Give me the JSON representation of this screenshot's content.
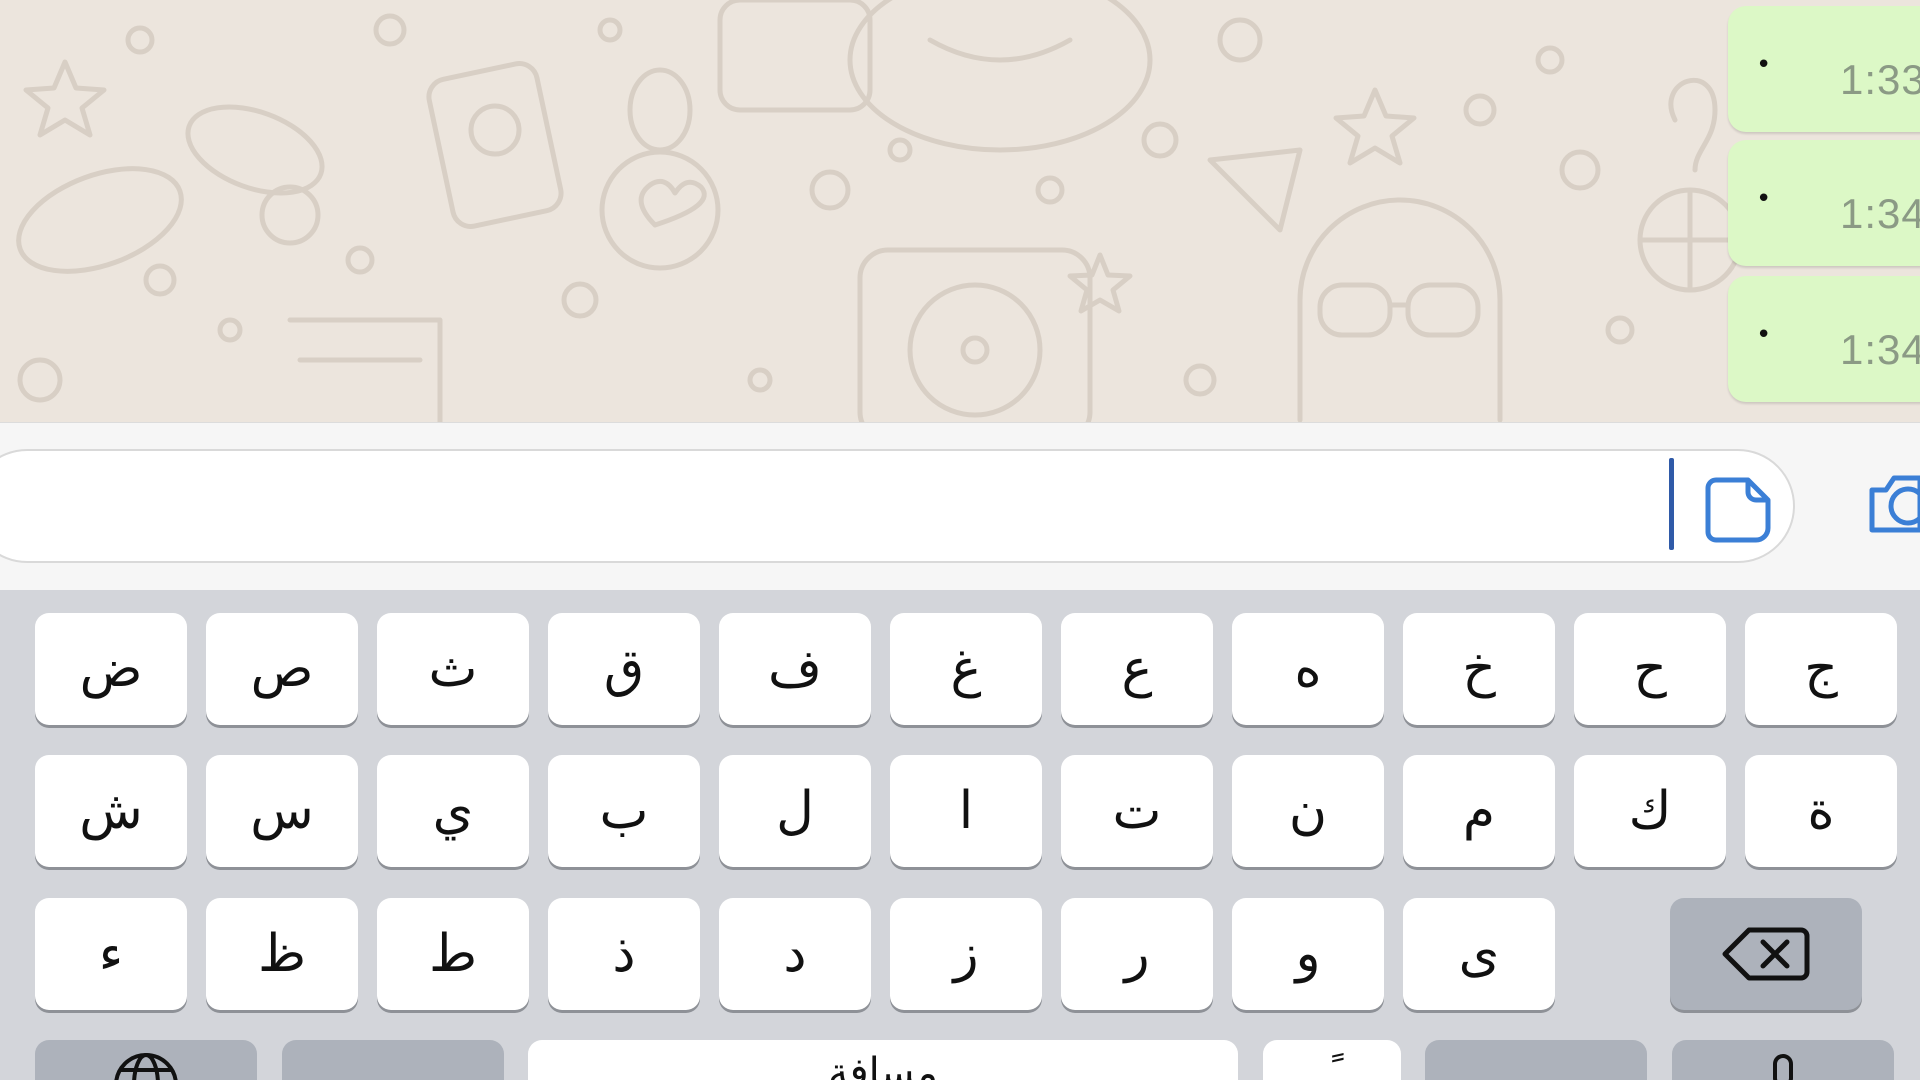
{
  "chat": {
    "messages": [
      {
        "text": "•",
        "time": "1:33"
      },
      {
        "text": "•",
        "time": "1:34"
      },
      {
        "text": "•",
        "time": "1:34"
      }
    ]
  },
  "input": {
    "value": "",
    "sticker_icon": "sticker-icon",
    "camera_icon": "camera-icon"
  },
  "keyboard": {
    "layout": "arabic",
    "row1": [
      "ج",
      "ح",
      "خ",
      "ه",
      "ع",
      "غ",
      "ف",
      "ق",
      "ث",
      "ص",
      "ض"
    ],
    "row2": [
      "ة",
      "ك",
      "م",
      "ن",
      "ت",
      "ا",
      "ل",
      "ب",
      "ي",
      "س",
      "ش"
    ],
    "row3": [
      "ى",
      "و",
      "ر",
      "ز",
      "د",
      "ذ",
      "ط",
      "ظ",
      "ء"
    ],
    "delete_icon": "backspace-icon",
    "bottom_row": {
      "globe_icon": "globe-icon",
      "space_label": "مسافة",
      "punct_label": "ـًـ",
      "mic_icon": "microphone-icon"
    }
  },
  "colors": {
    "chat_background": "#ece5dd",
    "outgoing_bubble": "#dcf8c6",
    "keyboard_background": "#d3d5da",
    "cursor": "#2f5aa8",
    "icon_blue": "#3b7fd6"
  }
}
